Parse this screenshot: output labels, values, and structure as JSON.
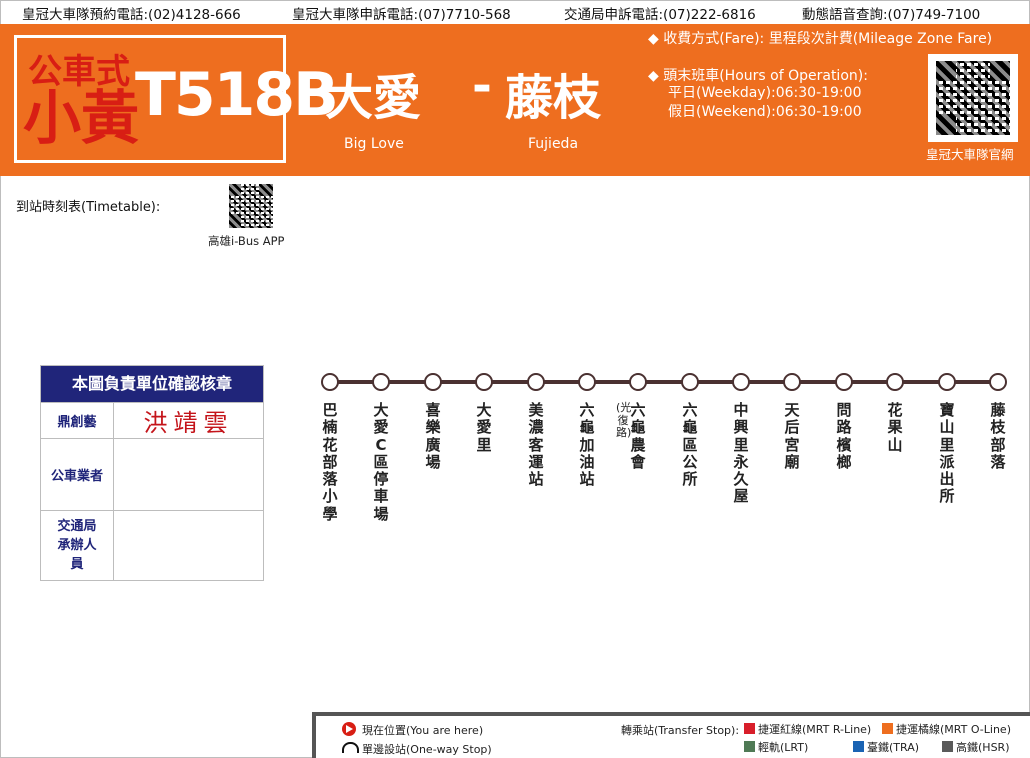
{
  "topbar": {
    "booking": "皇冠大車隊預約電話:(02)4128-666",
    "complaint": "皇冠大車隊申訴電話:(07)7710-568",
    "transport": "交通局申訴電話:(07)222-6816",
    "voice": "動態語音查詢:(07)749-7100"
  },
  "header": {
    "logo_small": "公車式",
    "logo_big": "小黃",
    "route_number": "T518B",
    "origin_zh": "大愛",
    "dash": "-",
    "dest_zh": "藤枝",
    "origin_en": "Big Love",
    "dest_en": "Fujieda",
    "fare": "◆ 收費方式(Fare): 里程段次計費(Mileage Zone Fare)",
    "hours_title": "◆ 頭末班車(Hours of Operation):",
    "weekday": "平日(Weekday):06:30-19:00",
    "weekend": "假日(Weekend):06:30-19:00",
    "qr_label": "皇冠大車隊官網",
    "qr_icon": "qr-code-icon"
  },
  "timetable": {
    "label": "到站時刻表(Timetable):",
    "qr_caption": "高雄i-Bus APP",
    "qr_icon": "qr-code-icon"
  },
  "approval": {
    "title": "本圖負責單位確認核章",
    "rows": [
      {
        "label": "鼎創藝",
        "value": "洪靖雲"
      },
      {
        "label": "公車業者",
        "value": ""
      },
      {
        "label": "交通局承辦人員",
        "value": ""
      }
    ]
  },
  "route": {
    "line_color": "#4a3131",
    "stops": [
      {
        "name": "巴楠花部落小學",
        "note": ""
      },
      {
        "name": "大愛C區停車場",
        "note": ""
      },
      {
        "name": "喜樂廣場",
        "note": ""
      },
      {
        "name": "大愛里",
        "note": ""
      },
      {
        "name": "美濃客運站",
        "note": ""
      },
      {
        "name": "六龜加油站",
        "note": ""
      },
      {
        "name": "六龜農會",
        "note": "(光復路)"
      },
      {
        "name": "六龜區公所",
        "note": ""
      },
      {
        "name": "中興里永久屋",
        "note": ""
      },
      {
        "name": "天后宮廟",
        "note": ""
      },
      {
        "name": "問路檳榔",
        "note": ""
      },
      {
        "name": "花果山",
        "note": ""
      },
      {
        "name": "寶山里派出所",
        "note": ""
      },
      {
        "name": "藤枝部落",
        "note": ""
      }
    ]
  },
  "legend": {
    "here": "現在位置(You are here)",
    "oneway": "單邊設站(One-way Stop)",
    "transfer": "轉乘站(Transfer Stop):",
    "items": [
      {
        "label": "捷運紅線(MRT R-Line)",
        "color": "#d81e2a"
      },
      {
        "label": "捷運橘線(MRT O-Line)",
        "color": "#ee6e1f"
      },
      {
        "label": "輕軌(LRT)",
        "color": "#4f7a55"
      },
      {
        "label": "臺鐵(TRA)",
        "color": "#1a63b3"
      },
      {
        "label": "高鐵(HSR)",
        "color": "#5a5a5a"
      }
    ]
  },
  "colors": {
    "header_bg": "#ee6e1f",
    "logo_red": "#d81e14",
    "approval_head": "#20257a"
  }
}
